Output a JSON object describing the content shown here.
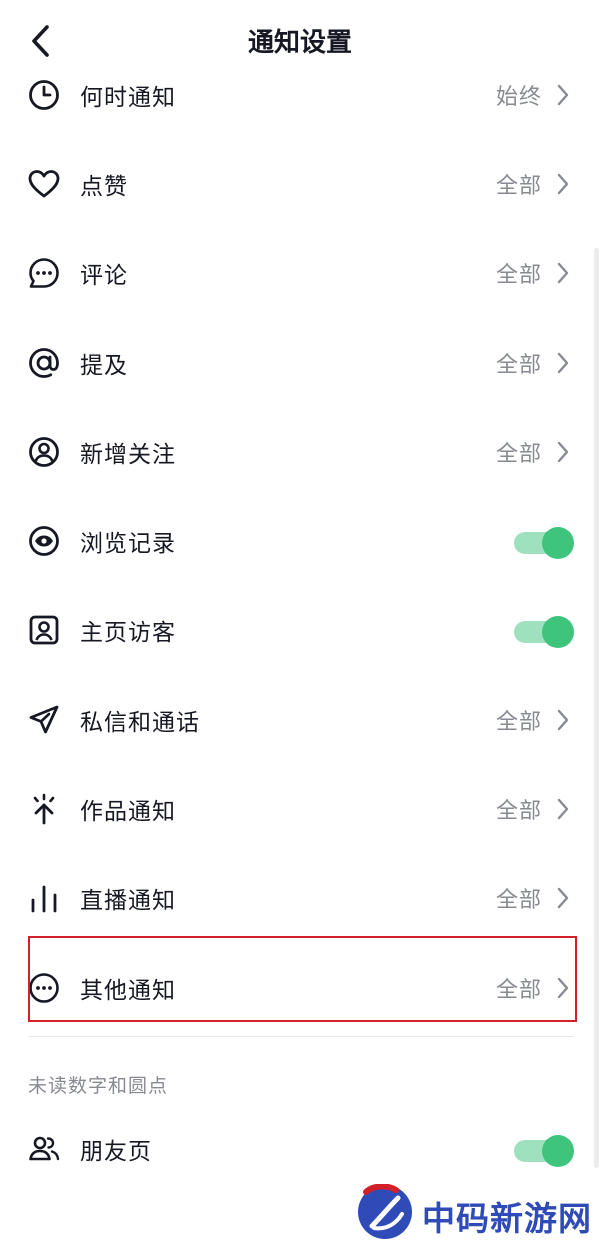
{
  "header": {
    "title": "通知设置",
    "back_icon": "chevron-left-icon"
  },
  "rows": [
    {
      "icon": "clock-icon",
      "label": "何时通知",
      "value": "始终",
      "type": "link"
    },
    {
      "icon": "heart-icon",
      "label": "点赞",
      "value": "全部",
      "type": "link"
    },
    {
      "icon": "comment-bubble-icon",
      "label": "评论",
      "value": "全部",
      "type": "link"
    },
    {
      "icon": "at-sign-icon",
      "label": "提及",
      "value": "全部",
      "type": "link"
    },
    {
      "icon": "user-circle-icon",
      "label": "新增关注",
      "value": "全部",
      "type": "link"
    },
    {
      "icon": "eye-icon",
      "label": "浏览记录",
      "value": "",
      "type": "toggle",
      "on": true
    },
    {
      "icon": "profile-frame-icon",
      "label": "主页访客",
      "value": "",
      "type": "toggle",
      "on": true
    },
    {
      "icon": "send-icon",
      "label": "私信和通话",
      "value": "全部",
      "type": "link"
    },
    {
      "icon": "sparkle-icon",
      "label": "作品通知",
      "value": "全部",
      "type": "link"
    },
    {
      "icon": "bars-icon",
      "label": "直播通知",
      "value": "全部",
      "type": "link"
    },
    {
      "icon": "more-dots-icon",
      "label": "其他通知",
      "value": "全部",
      "type": "link"
    }
  ],
  "unread_section": {
    "title": "未读数字和圆点",
    "friend": {
      "icon": "friends-icon",
      "label": "朋友页",
      "on": true
    }
  },
  "watermark": {
    "text": "中码新游网"
  },
  "colors": {
    "toggle_on": "#3ec57b",
    "toggle_track": "#9fe0bf",
    "highlight": "#d21f2a",
    "secondary_text": "#878a91"
  }
}
